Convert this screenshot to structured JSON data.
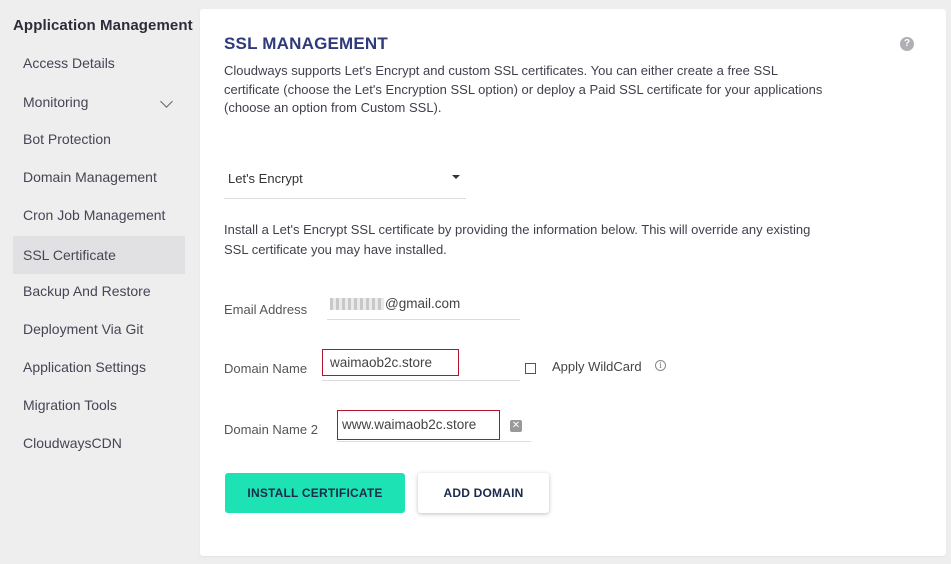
{
  "sidebar": {
    "title": "Application Management",
    "items": [
      {
        "label": "Access Details"
      },
      {
        "label": "Monitoring"
      },
      {
        "label": "Bot Protection"
      },
      {
        "label": "Domain Management"
      },
      {
        "label": "Cron Job Management"
      },
      {
        "label": "SSL Certificate",
        "active": true
      },
      {
        "label": "Backup And Restore"
      },
      {
        "label": "Deployment Via Git"
      },
      {
        "label": "Application Settings"
      },
      {
        "label": "Migration Tools"
      },
      {
        "label": "CloudwaysCDN"
      }
    ]
  },
  "ssl": {
    "title": "SSL MANAGEMENT",
    "description": "Cloudways supports Let's Encrypt and custom SSL certificates. You can either create a free SSL certificate (choose the Let's Encryption SSL option) or deploy a Paid SSL certificate for your applications (choose an option from Custom SSL).",
    "provider_selected": "Let's Encrypt",
    "info_text": "Install a Let's Encrypt SSL certificate by providing the information below. This will override any existing SSL certificate you may have installed.",
    "email_label": "Email Address",
    "email_value": "@gmail.com",
    "domain_label": "Domain Name",
    "domain_value": "waimaob2c.store",
    "wildcard_label": "Apply WildCard",
    "wildcard_checked": false,
    "domain2_label": "Domain Name 2",
    "domain2_value": "www.waimaob2c.store",
    "install_button": "INSTALL CERTIFICATE",
    "add_domain_button": "ADD DOMAIN"
  },
  "colors": {
    "accent": "#1de3b4",
    "title": "#2f3a7a",
    "highlight_border": "#b2132f"
  }
}
